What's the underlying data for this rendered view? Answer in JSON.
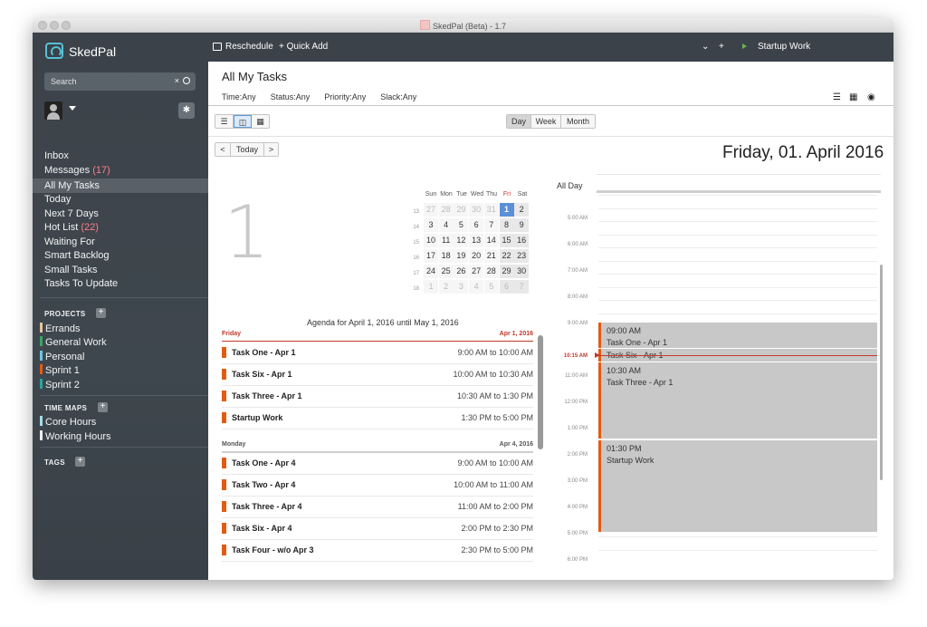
{
  "window": {
    "title": "SkedPal (Beta) - 1.7"
  },
  "sidebar": {
    "brand": "SkedPal",
    "search_placeholder": "Search",
    "search_clear": "×",
    "nav": [
      {
        "label": "Inbox",
        "count": ""
      },
      {
        "label": "Messages",
        "count": "(17)"
      },
      {
        "label": "All My Tasks",
        "count": ""
      },
      {
        "label": "Today",
        "count": ""
      },
      {
        "label": "Next 7 Days",
        "count": ""
      },
      {
        "label": "Hot List",
        "count": "(22)"
      },
      {
        "label": "Waiting For",
        "count": ""
      },
      {
        "label": "Smart Backlog",
        "count": ""
      },
      {
        "label": "Small Tasks",
        "count": ""
      },
      {
        "label": "Tasks To Update",
        "count": ""
      }
    ],
    "projects_label": "PROJECTS",
    "projects": [
      {
        "label": "Errands",
        "color": "#e8c39b"
      },
      {
        "label": "General Work",
        "color": "#3aa66a"
      },
      {
        "label": "Personal",
        "color": "#6fc6dc"
      },
      {
        "label": "Sprint 1",
        "color": "#e35b12"
      },
      {
        "label": "Sprint 2",
        "color": "#2aa3a3"
      }
    ],
    "time_maps_label": "TIME MAPS",
    "time_maps": [
      {
        "label": "Core Hours",
        "color": "#a6dbe6"
      },
      {
        "label": "Working Hours",
        "color": "#eeeeee"
      }
    ],
    "tags_label": "TAGS"
  },
  "toolbar": {
    "reschedule": "Reschedule",
    "quick_add": "+ Quick Add",
    "plus": "+",
    "running_task": "Startup Work"
  },
  "header": {
    "title": "All My Tasks",
    "filters": [
      "Time:Any",
      "Status:Any",
      "Priority:Any",
      "Slack:Any"
    ]
  },
  "calendar_nav": {
    "prev": "<",
    "today": "Today",
    "next": ">",
    "views": [
      "Day",
      "Week",
      "Month"
    ],
    "active_view": "Day",
    "long_date": "Friday, 01. April 2016",
    "big_day": "1"
  },
  "mini_calendar": {
    "weekdays": [
      "Sun",
      "Mon",
      "Tue",
      "Wed",
      "Thu",
      "Fri",
      "Sat"
    ],
    "weeks": [
      {
        "num": "13",
        "days": [
          "27",
          "28",
          "29",
          "30",
          "31",
          "1",
          "2"
        ]
      },
      {
        "num": "14",
        "days": [
          "3",
          "4",
          "5",
          "6",
          "7",
          "8",
          "9"
        ]
      },
      {
        "num": "15",
        "days": [
          "10",
          "11",
          "12",
          "13",
          "14",
          "15",
          "16"
        ]
      },
      {
        "num": "16",
        "days": [
          "17",
          "18",
          "19",
          "20",
          "21",
          "22",
          "23"
        ]
      },
      {
        "num": "17",
        "days": [
          "24",
          "25",
          "26",
          "27",
          "28",
          "29",
          "30"
        ]
      },
      {
        "num": "18",
        "days": [
          "1",
          "2",
          "3",
          "4",
          "5",
          "6",
          "7"
        ]
      }
    ]
  },
  "agenda": {
    "title": "Agenda for April 1, 2016 until May 1, 2016",
    "days": [
      {
        "day": "Friday",
        "date": "Apr 1, 2016",
        "accent": "#c0392b",
        "tasks": [
          {
            "name": "Task One - Apr  1",
            "time": "9:00 AM to 10:00 AM"
          },
          {
            "name": "Task Six - Apr  1",
            "time": "10:00 AM to 10:30 AM"
          },
          {
            "name": "Task Three - Apr  1",
            "time": "10:30 AM to 1:30 PM"
          },
          {
            "name": "Startup Work",
            "time": "1:30 PM to 5:00 PM"
          }
        ]
      },
      {
        "day": "Monday",
        "date": "Apr 4, 2016",
        "accent": "#555555",
        "tasks": [
          {
            "name": "Task One - Apr  4",
            "time": "9:00 AM to 10:00 AM"
          },
          {
            "name": "Task Two - Apr  4",
            "time": "10:00 AM to 11:00 AM"
          },
          {
            "name": "Task Three - Apr  4",
            "time": "11:00 AM to 2:00 PM"
          },
          {
            "name": "Task Six - Apr  4",
            "time": "2:00 PM to 2:30 PM"
          },
          {
            "name": "Task Four - w/o Apr  3",
            "time": "2:30 PM to 5:00 PM"
          }
        ]
      }
    ]
  },
  "day_view": {
    "all_day_label": "All Day",
    "time_labels": [
      "5:00 AM",
      "6:00 AM",
      "7:00 AM",
      "8:00 AM",
      "9:00 AM",
      "10:15 AM",
      "11:00 AM",
      "12:00 PM",
      "1:00 PM",
      "2:00 PM",
      "3:00 PM",
      "4:00 PM",
      "5:00 PM",
      "6:00 PM"
    ],
    "now_label": "10:15 AM",
    "events": [
      {
        "time": "09:00 AM",
        "name": "Task One - Apr  1"
      },
      {
        "time": "",
        "name": "Task Six - Apr  1"
      },
      {
        "time": "10:30 AM",
        "name": "Task Three - Apr  1"
      },
      {
        "time": "01:30 PM",
        "name": "Startup Work"
      }
    ]
  },
  "colors": {
    "accent": "#e35b12",
    "sidebar_bg": "#3f474e",
    "today": "#5b8fd8",
    "now": "#c0392b"
  }
}
